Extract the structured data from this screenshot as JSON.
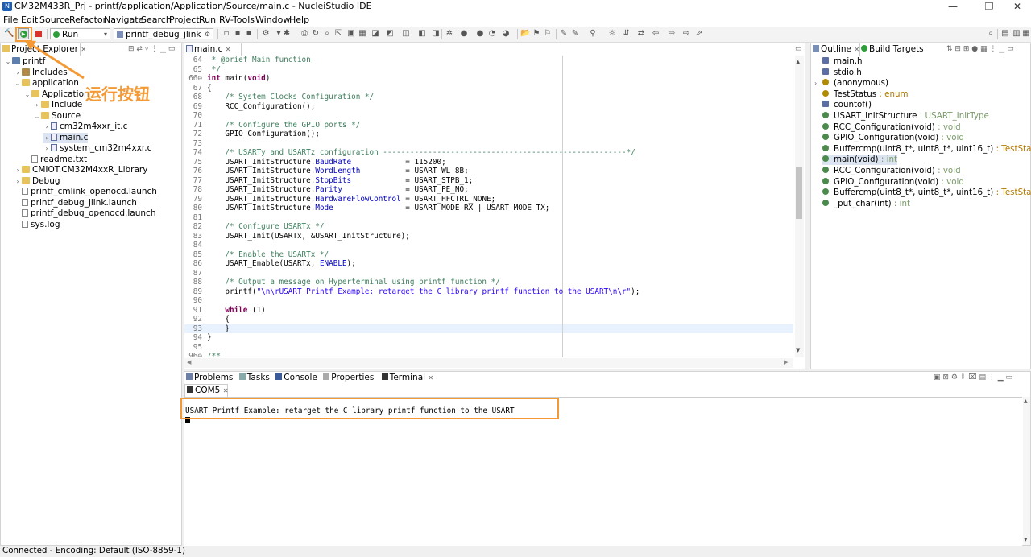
{
  "window": {
    "title": "CM32M433R_Prj - printf/application/Application/Source/main.c - NucleiStudio IDE",
    "app_icon": "nuclei-icon",
    "controls": [
      "minimize-icon",
      "maximize-icon",
      "close-icon"
    ]
  },
  "menu": [
    "File",
    "Edit",
    "Source",
    "Refactor",
    "Navigate",
    "Search",
    "Project",
    "Run",
    "RV-Tools",
    "Window",
    "Help"
  ],
  "toolbar": {
    "launch_mode": "Run",
    "launch_config": "printf_debug_jlink"
  },
  "annotation": {
    "label": "运行按钮",
    "color": "#f39a36"
  },
  "project_explorer": {
    "tab_label": "Project Explorer",
    "items": [
      {
        "label": "printf",
        "depth": 0,
        "twisty": "⌄",
        "icon": "project"
      },
      {
        "label": "Includes",
        "depth": 1,
        "twisty": "›",
        "icon": "lib"
      },
      {
        "label": "application",
        "depth": 1,
        "twisty": "⌄",
        "icon": "folder"
      },
      {
        "label": "Application",
        "depth": 2,
        "twisty": "⌄",
        "icon": "folder"
      },
      {
        "label": "Include",
        "depth": 3,
        "twisty": "›",
        "icon": "folder"
      },
      {
        "label": "Source",
        "depth": 3,
        "twisty": "⌄",
        "icon": "folder"
      },
      {
        "label": "cm32m4xxr_it.c",
        "depth": 4,
        "twisty": "›",
        "icon": "cfile"
      },
      {
        "label": "main.c",
        "depth": 4,
        "twisty": "›",
        "icon": "cfile",
        "selected": true
      },
      {
        "label": "system_cm32m4xxr.c",
        "depth": 4,
        "twisty": "›",
        "icon": "cfile"
      },
      {
        "label": "readme.txt",
        "depth": 2,
        "twisty": "",
        "icon": "file"
      },
      {
        "label": "CMIOT.CM32M4xxR_Library",
        "depth": 1,
        "twisty": "›",
        "icon": "folder"
      },
      {
        "label": "Debug",
        "depth": 1,
        "twisty": "›",
        "icon": "folder"
      },
      {
        "label": "printf_cmlink_openocd.launch",
        "depth": 1,
        "twisty": "",
        "icon": "file"
      },
      {
        "label": "printf_debug_jlink.launch",
        "depth": 1,
        "twisty": "",
        "icon": "file"
      },
      {
        "label": "printf_debug_openocd.launch",
        "depth": 1,
        "twisty": "",
        "icon": "file"
      },
      {
        "label": "sys.log",
        "depth": 1,
        "twisty": "",
        "icon": "file"
      }
    ]
  },
  "editor": {
    "tab_label": "main.c",
    "lines": [
      {
        "n": "64",
        "segs": [
          {
            "t": " * ",
            "c": "cm"
          },
          {
            "t": "@brief",
            "c": "cm"
          },
          {
            "t": " Main function",
            "c": "cm"
          }
        ]
      },
      {
        "n": "65",
        "segs": [
          {
            "t": " */",
            "c": "cm"
          }
        ]
      },
      {
        "n": "66⊖",
        "segs": [
          {
            "t": "int",
            "c": "kw"
          },
          {
            "t": " main(",
            "c": ""
          },
          {
            "t": "void",
            "c": "kw"
          },
          {
            "t": ")",
            "c": ""
          }
        ]
      },
      {
        "n": "67",
        "segs": [
          {
            "t": "{",
            "c": ""
          }
        ]
      },
      {
        "n": "68",
        "segs": [
          {
            "t": "    /* System Clocks Configuration */",
            "c": "cm"
          }
        ]
      },
      {
        "n": "69",
        "segs": [
          {
            "t": "    RCC_Configuration();",
            "c": ""
          }
        ]
      },
      {
        "n": "70",
        "segs": []
      },
      {
        "n": "71",
        "segs": [
          {
            "t": "    /* Configure the GPIO ports */",
            "c": "cm"
          }
        ]
      },
      {
        "n": "72",
        "segs": [
          {
            "t": "    GPIO_Configuration();",
            "c": ""
          }
        ]
      },
      {
        "n": "73",
        "segs": []
      },
      {
        "n": "74",
        "segs": [
          {
            "t": "    /* USARTy and USARTz configuration ------------------------------------------------------*/",
            "c": "cm"
          }
        ]
      },
      {
        "n": "75",
        "segs": [
          {
            "t": "    USART_InitStructure.",
            "c": ""
          },
          {
            "t": "BaudRate",
            "c": "fld"
          },
          {
            "t": "            = 115200;",
            "c": ""
          }
        ]
      },
      {
        "n": "76",
        "segs": [
          {
            "t": "    USART_InitStructure.",
            "c": ""
          },
          {
            "t": "WordLength",
            "c": "fld"
          },
          {
            "t": "          = USART_WL_8B;",
            "c": ""
          }
        ]
      },
      {
        "n": "77",
        "segs": [
          {
            "t": "    USART_InitStructure.",
            "c": ""
          },
          {
            "t": "StopBits",
            "c": "fld"
          },
          {
            "t": "            = USART_STPB_1;",
            "c": ""
          }
        ]
      },
      {
        "n": "78",
        "segs": [
          {
            "t": "    USART_InitStructure.",
            "c": ""
          },
          {
            "t": "Parity",
            "c": "fld"
          },
          {
            "t": "              = USART_PE_NO;",
            "c": ""
          }
        ]
      },
      {
        "n": "79",
        "segs": [
          {
            "t": "    USART_InitStructure.",
            "c": ""
          },
          {
            "t": "HardwareFlowControl",
            "c": "fld"
          },
          {
            "t": " = USART_HFCTRL_NONE;",
            "c": ""
          }
        ]
      },
      {
        "n": "80",
        "segs": [
          {
            "t": "    USART_InitStructure.",
            "c": ""
          },
          {
            "t": "Mode",
            "c": "fld"
          },
          {
            "t": "                = USART_MODE_RX | USART_MODE_TX;",
            "c": ""
          }
        ]
      },
      {
        "n": "81",
        "segs": []
      },
      {
        "n": "82",
        "segs": [
          {
            "t": "    /* Configure USARTx */",
            "c": "cm"
          }
        ]
      },
      {
        "n": "83",
        "segs": [
          {
            "t": "    USART_Init(USARTx, &USART_InitStructure);",
            "c": ""
          }
        ]
      },
      {
        "n": "84",
        "segs": []
      },
      {
        "n": "85",
        "segs": [
          {
            "t": "    /* Enable the USARTx */",
            "c": "cm"
          }
        ]
      },
      {
        "n": "86",
        "segs": [
          {
            "t": "    USART_Enable(USARTx, ",
            "c": ""
          },
          {
            "t": "ENABLE",
            "c": "fld"
          },
          {
            "t": ");",
            "c": ""
          }
        ]
      },
      {
        "n": "87",
        "segs": []
      },
      {
        "n": "88",
        "segs": [
          {
            "t": "    /* Output a message on Hyperterminal using printf function */",
            "c": "cm"
          }
        ]
      },
      {
        "n": "89",
        "segs": [
          {
            "t": "    printf(",
            "c": ""
          },
          {
            "t": "\"\\n\\rUSART Printf Example: retarget the C library printf function to the USART\\n\\r\"",
            "c": "str"
          },
          {
            "t": ");",
            "c": ""
          }
        ]
      },
      {
        "n": "90",
        "segs": []
      },
      {
        "n": "91",
        "segs": [
          {
            "t": "    ",
            "c": ""
          },
          {
            "t": "while",
            "c": "kw"
          },
          {
            "t": " (1)",
            "c": ""
          }
        ]
      },
      {
        "n": "92",
        "segs": [
          {
            "t": "    {",
            "c": ""
          }
        ]
      },
      {
        "n": "93",
        "segs": [
          {
            "t": "    }",
            "c": ""
          }
        ]
      },
      {
        "n": "94",
        "segs": [
          {
            "t": "}",
            "c": ""
          }
        ]
      },
      {
        "n": "95",
        "segs": []
      },
      {
        "n": "96⊖",
        "segs": [
          {
            "t": "/**",
            "c": "cm"
          }
        ]
      }
    ]
  },
  "outline": {
    "tabs": [
      "Outline",
      "Build Targets"
    ],
    "items": [
      {
        "label": "main.h",
        "type": "",
        "icon": "include",
        "color": "#5b6fa6"
      },
      {
        "label": "stdio.h",
        "type": "",
        "icon": "include",
        "color": "#5b6fa6"
      },
      {
        "label": "(anonymous)",
        "type": "",
        "icon": "enum",
        "color": "#b08a00",
        "twisty": "›"
      },
      {
        "label": "TestStatus",
        "type": " : enum",
        "icon": "typedef",
        "color": "#b08a00"
      },
      {
        "label": "countof()",
        "type": "",
        "icon": "macro",
        "color": "#5b6fa6"
      },
      {
        "label": "USART_InitStructure",
        "type": " : USART_InitType",
        "icon": "var",
        "color": "#4a8a4a"
      },
      {
        "label": "RCC_Configuration(void)",
        "type": " : void",
        "icon": "func-decl",
        "color": "#4a8a4a"
      },
      {
        "label": "GPIO_Configuration(void)",
        "type": " : void",
        "icon": "func-decl",
        "color": "#4a8a4a"
      },
      {
        "label": "Buffercmp(uint8_t*, uint8_t*, uint16_t)",
        "type": " : TestStatus",
        "icon": "func-decl",
        "color": "#4a8a4a"
      },
      {
        "label": "main(void)",
        "type": " : int",
        "icon": "func",
        "color": "#4a8a4a",
        "selected": true
      },
      {
        "label": "RCC_Configuration(void)",
        "type": " : void",
        "icon": "func",
        "color": "#4a8a4a"
      },
      {
        "label": "GPIO_Configuration(void)",
        "type": " : void",
        "icon": "func",
        "color": "#4a8a4a"
      },
      {
        "label": "Buffercmp(uint8_t*, uint8_t*, uint16_t)",
        "type": " : TestStatus",
        "icon": "func",
        "color": "#4a8a4a"
      },
      {
        "label": "_put_char(int)",
        "type": " : int",
        "icon": "func",
        "color": "#4a8a4a"
      }
    ]
  },
  "bottom_panel": {
    "tabs": [
      "Problems",
      "Tasks",
      "Console",
      "Properties",
      "Terminal"
    ],
    "terminal_tab": "COM5",
    "output": "USART Printf Example: retarget the C library printf function to the USART"
  },
  "status_bar": {
    "text": "Connected - Encoding: Default (ISO-8859-1)"
  }
}
